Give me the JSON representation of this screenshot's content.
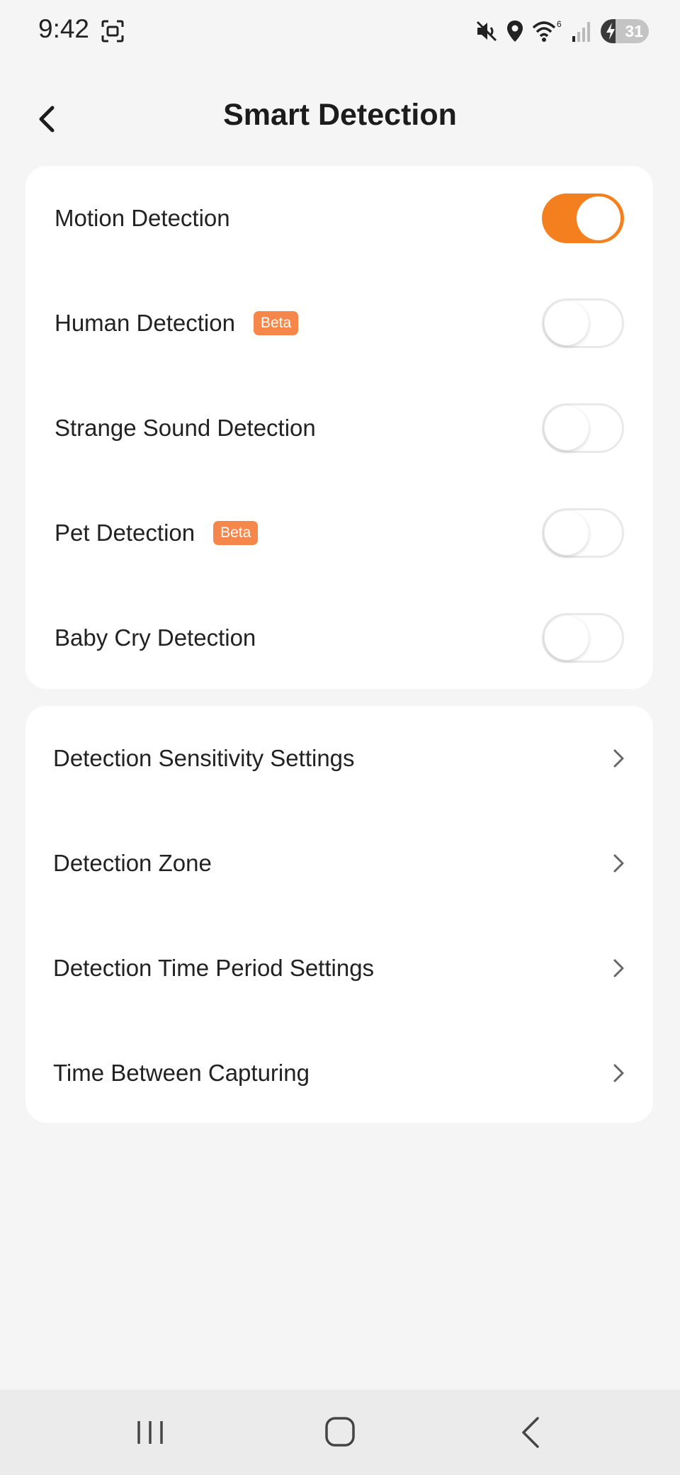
{
  "status_bar": {
    "time": "9:42",
    "battery_level": "31",
    "battery_fraction": 0.31,
    "wifi_label": "6",
    "icons": [
      "screenshot-icon",
      "mute-icon",
      "location-icon",
      "wifi-icon",
      "signal-icon",
      "battery-icon"
    ]
  },
  "header": {
    "title": "Smart Detection",
    "back_icon": "chevron-left-icon"
  },
  "detection_toggles": [
    {
      "label": "Motion Detection",
      "badge": "",
      "enabled": true
    },
    {
      "label": "Human Detection",
      "badge": "Beta",
      "enabled": false
    },
    {
      "label": "Strange Sound Detection",
      "badge": "",
      "enabled": false
    },
    {
      "label": "Pet Detection",
      "badge": "Beta",
      "enabled": false
    },
    {
      "label": "Baby Cry Detection",
      "badge": "",
      "enabled": false
    }
  ],
  "settings_links": [
    {
      "label": "Detection Sensitivity Settings"
    },
    {
      "label": "Detection Zone"
    },
    {
      "label": "Detection Time Period Settings"
    },
    {
      "label": "Time Between Capturing"
    }
  ],
  "nav_bar": {
    "icons": [
      "recent-apps-icon",
      "home-icon",
      "back-icon"
    ]
  },
  "colors": {
    "accent": "#f47f1e",
    "badge": "#f5874a",
    "background": "#f5f5f5",
    "card": "#ffffff"
  }
}
